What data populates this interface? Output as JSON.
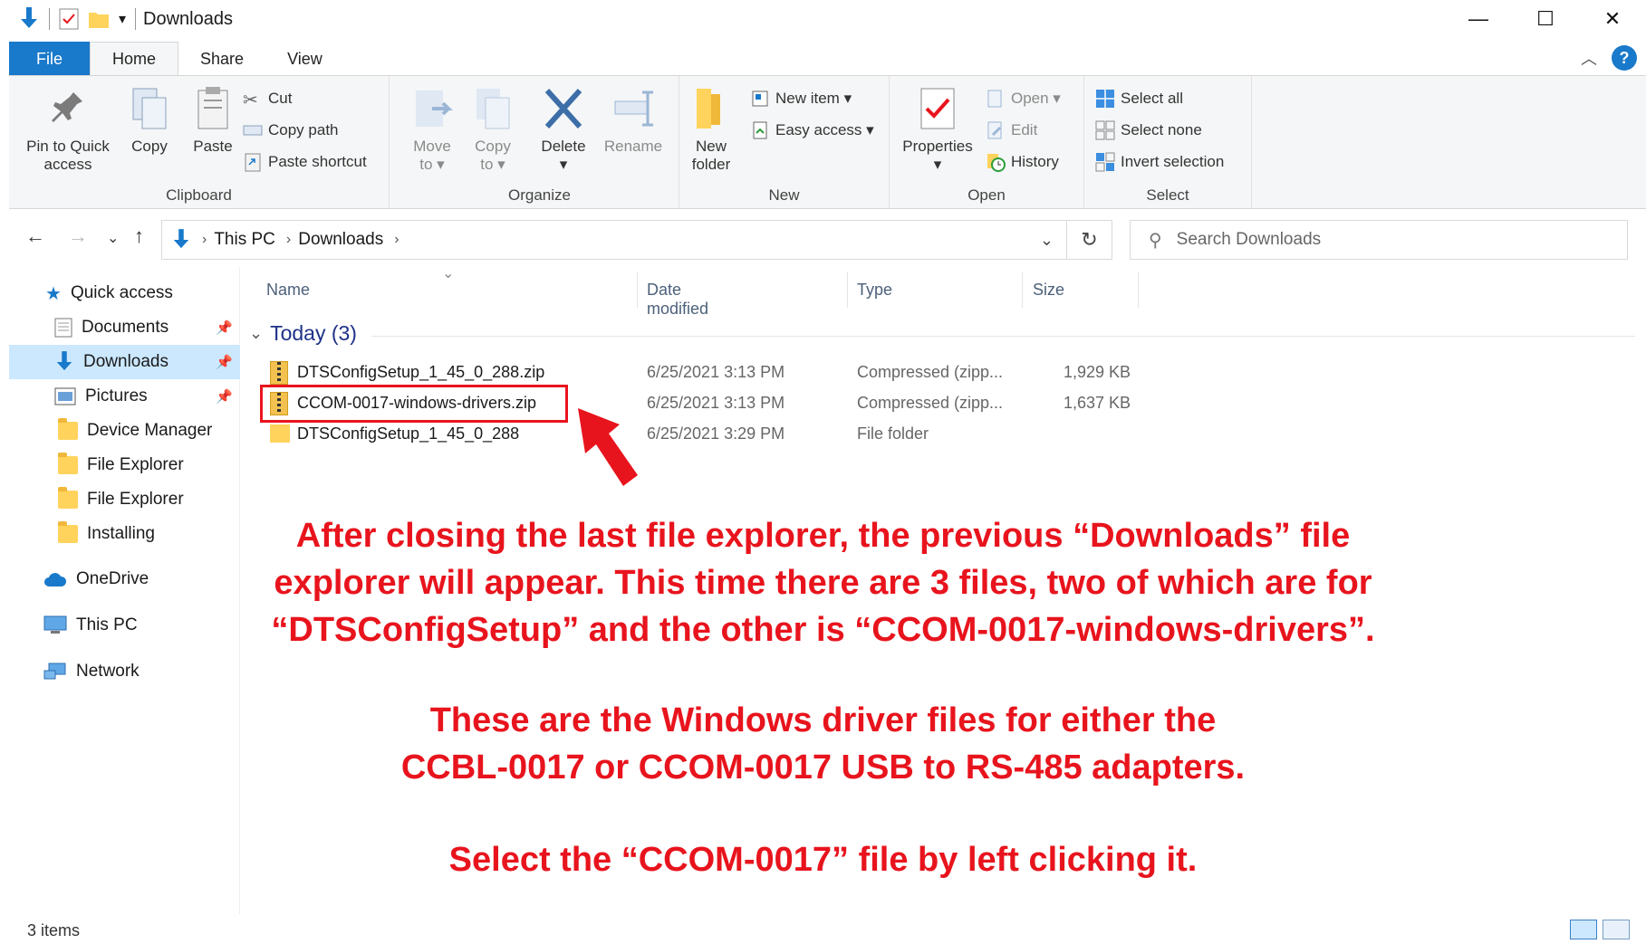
{
  "window": {
    "title": "Downloads",
    "controls": {
      "minimize": "—",
      "maximize": "☐",
      "close": "✕"
    }
  },
  "ribbon_tabs": [
    "File",
    "Home",
    "Share",
    "View"
  ],
  "ribbon": {
    "clipboard": {
      "label": "Clipboard",
      "pin_line1": "Pin to Quick",
      "pin_line2": "access",
      "copy": "Copy",
      "paste": "Paste",
      "cut": "Cut",
      "copy_path": "Copy path",
      "paste_shortcut": "Paste shortcut"
    },
    "organize": {
      "label": "Organize",
      "move_line1": "Move",
      "move_line2": "to ▾",
      "copy_line1": "Copy",
      "copy_line2": "to ▾",
      "delete_line1": "Delete",
      "delete_line2": "▾",
      "rename": "Rename"
    },
    "new": {
      "label": "New",
      "new_folder_line1": "New",
      "new_folder_line2": "folder",
      "new_item": "New item ▾",
      "easy_access": "Easy access ▾"
    },
    "open": {
      "label": "Open",
      "properties_line1": "Properties",
      "properties_line2": "▾",
      "open": "Open ▾",
      "edit": "Edit",
      "history": "History"
    },
    "select": {
      "label": "Select",
      "select_all": "Select all",
      "select_none": "Select none",
      "invert": "Invert selection"
    }
  },
  "address": {
    "crumbs": [
      "This PC",
      "Downloads"
    ],
    "search_placeholder": "Search Downloads"
  },
  "nav_pane": {
    "quick_access": "Quick access",
    "items": [
      "Documents",
      "Downloads",
      "Pictures",
      "Device Manager",
      "File Explorer",
      "File Explorer",
      "Installing"
    ],
    "onedrive": "OneDrive",
    "this_pc": "This PC",
    "network": "Network"
  },
  "columns": [
    "Name",
    "Date modified",
    "Type",
    "Size"
  ],
  "group_header": "Today (3)",
  "files": [
    {
      "name": "DTSConfigSetup_1_45_0_288.zip",
      "date": "6/25/2021 3:13 PM",
      "type": "Compressed (zipp...",
      "size": "1,929 KB",
      "kind": "zip"
    },
    {
      "name": "CCOM-0017-windows-drivers.zip",
      "date": "6/25/2021 3:13 PM",
      "type": "Compressed (zipp...",
      "size": "1,637 KB",
      "kind": "zip"
    },
    {
      "name": "DTSConfigSetup_1_45_0_288",
      "date": "6/25/2021 3:29 PM",
      "type": "File folder",
      "size": "",
      "kind": "folder"
    }
  ],
  "annotation": {
    "para1": [
      "After closing the last file explorer, the previous “Downloads” file",
      "explorer will appear. This time there are 3 files, two of which are for",
      "“DTSConfigSetup” and the other is “CCOM-0017-windows-drivers”."
    ],
    "para2": [
      "These are the Windows driver files for either the",
      "CCBL-0017 or CCOM-0017 USB to RS-485 adapters."
    ],
    "para3": "Select the “CCOM-0017” file by left clicking it."
  },
  "status": {
    "items": "3 items"
  },
  "colors": {
    "accent": "#1979ca",
    "annotation_red": "#e8141d",
    "selection": "#cce8ff"
  }
}
